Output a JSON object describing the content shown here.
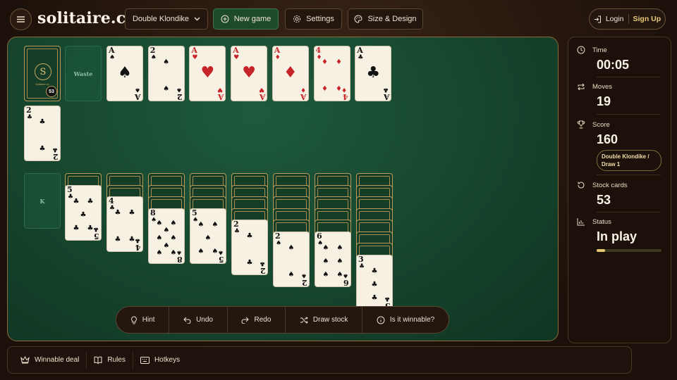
{
  "header": {
    "logo": "solitaire.cx",
    "game_select": "Double Klondike",
    "new_game": "New game",
    "settings": "Settings",
    "size_design": "Size & Design",
    "login": "Login",
    "signup": "Sign Up"
  },
  "board": {
    "stock": {
      "count": "53",
      "emblem": "S",
      "name": "Solitaire.cx"
    },
    "waste_label": "Waste",
    "king_slot_label": "K",
    "foundations": [
      {
        "rank": "A",
        "suit": "♠",
        "color": "black"
      },
      {
        "rank": "2",
        "suit": "♠",
        "color": "black"
      },
      {
        "rank": "A",
        "suit": "♥",
        "color": "red"
      },
      {
        "rank": "A",
        "suit": "♥",
        "color": "red"
      },
      {
        "rank": "A",
        "suit": "♦",
        "color": "red"
      },
      {
        "rank": "4",
        "suit": "♦",
        "color": "red"
      },
      {
        "rank": "A",
        "suit": "♣",
        "color": "black"
      }
    ],
    "extra_foundation": {
      "rank": "2",
      "suit": "♣",
      "color": "black"
    },
    "tableau": [
      {
        "hidden": 1,
        "rank": "5",
        "suit": "♣",
        "color": "black"
      },
      {
        "hidden": 2,
        "rank": "4",
        "suit": "♣",
        "color": "black"
      },
      {
        "hidden": 3,
        "rank": "8",
        "suit": "♠",
        "color": "black"
      },
      {
        "hidden": 3,
        "rank": "5",
        "suit": "♠",
        "color": "black"
      },
      {
        "hidden": 4,
        "rank": "2",
        "suit": "♣",
        "color": "black"
      },
      {
        "hidden": 5,
        "rank": "2",
        "suit": "♠",
        "color": "black"
      },
      {
        "hidden": 5,
        "rank": "6",
        "suit": "♠",
        "color": "black"
      },
      {
        "hidden": 7,
        "rank": "3",
        "suit": "♣",
        "color": "black"
      }
    ]
  },
  "actions": {
    "hint": "Hint",
    "undo": "Undo",
    "redo": "Redo",
    "draw_stock": "Draw stock",
    "winnable": "Is it winnable?"
  },
  "sidebar": {
    "time_label": "Time",
    "time_value": "00:05",
    "moves_label": "Moves",
    "moves_value": "19",
    "score_label": "Score",
    "score_value": "160",
    "mode_pill": "Double Klondike / Draw 1",
    "stock_label": "Stock cards",
    "stock_value": "53",
    "status_label": "Status",
    "status_value": "In play",
    "status_progress": 0.13
  },
  "footer": {
    "winnable_deal": "Winnable deal",
    "rules": "Rules",
    "hotkeys": "Hotkeys"
  },
  "colors": {
    "accent": "#e8c879",
    "felt": "#15432c",
    "red_suit": "#c7242a"
  }
}
